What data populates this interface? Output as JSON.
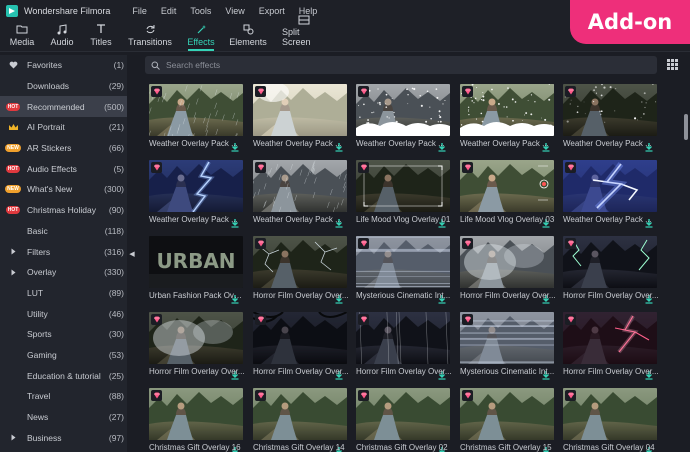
{
  "app": {
    "title": "Wondershare Filmora"
  },
  "menu": [
    "File",
    "Edit",
    "Tools",
    "View",
    "Export",
    "Help"
  ],
  "badge": "Add-on",
  "tabs": [
    {
      "label": "Media",
      "icon": "folder-icon"
    },
    {
      "label": "Audio",
      "icon": "music-note-icon"
    },
    {
      "label": "Titles",
      "icon": "text-t-icon"
    },
    {
      "label": "Transitions",
      "icon": "transition-icon"
    },
    {
      "label": "Effects",
      "icon": "effects-sparkle-icon",
      "active": true
    },
    {
      "label": "Elements",
      "icon": "elements-icon"
    },
    {
      "label": "Split Screen",
      "icon": "split-screen-icon"
    }
  ],
  "sidebar": {
    "items": [
      {
        "label": "Favorites",
        "count": "(1)",
        "icon": "heart-icon"
      },
      {
        "label": "Downloads",
        "count": "(29)",
        "icon": ""
      },
      {
        "label": "Recommended",
        "count": "(500)",
        "icon": "hot-pill",
        "pill": "HOT",
        "active": true
      },
      {
        "label": "AI Portrait",
        "count": "(21)",
        "icon": "crown-icon"
      },
      {
        "label": "AR Stickers",
        "count": "(66)",
        "icon": "new-pill",
        "pill": "NEW"
      },
      {
        "label": "Audio Effects",
        "count": "(5)",
        "icon": "hot-pill",
        "pill": "HOT"
      },
      {
        "label": "What's New",
        "count": "(300)",
        "icon": "new-pill",
        "pill": "NEW"
      },
      {
        "label": "Christmas Holiday",
        "count": "(90)",
        "icon": "hot-pill",
        "pill": "HOT"
      },
      {
        "label": "Basic",
        "count": "(118)",
        "icon": ""
      },
      {
        "label": "Filters",
        "count": "(316)",
        "icon": "expand-arrow-icon"
      },
      {
        "label": "Overlay",
        "count": "(330)",
        "icon": "expand-arrow-icon"
      },
      {
        "label": "LUT",
        "count": "(89)",
        "icon": ""
      },
      {
        "label": "Utility",
        "count": "(46)",
        "icon": ""
      },
      {
        "label": "Sports",
        "count": "(30)",
        "icon": ""
      },
      {
        "label": "Gaming",
        "count": "(53)",
        "icon": ""
      },
      {
        "label": "Education & tutorial",
        "count": "(25)",
        "icon": ""
      },
      {
        "label": "Travel",
        "count": "(88)",
        "icon": ""
      },
      {
        "label": "News",
        "count": "(27)",
        "icon": ""
      },
      {
        "label": "Business",
        "count": "(97)",
        "icon": "expand-arrow-icon"
      }
    ]
  },
  "search": {
    "placeholder": "Search effects"
  },
  "effects": [
    [
      "Weather Overlay Pack ...",
      "Weather Overlay Pack ...",
      "Weather Overlay Pack ...",
      "Weather Overlay Pack ...",
      "Weather Overlay Pack ..."
    ],
    [
      "Weather Overlay Pack ...",
      "Weather Overlay Pack ...",
      "Life Mood Vlog Overlay 01",
      "Life Mood Vlog Overlay 03",
      "Weather Overlay Pack ..."
    ],
    [
      "Urban Fashion Pack Over...",
      "Horror Film Overlay Over...",
      "Mysterious Cinematic Int...",
      "Horror Film Overlay Over...",
      "Horror Film Overlay Over..."
    ],
    [
      "Horror Film Overlay Over...",
      "Horror Film Overlay Over...",
      "Horror Film Overlay Over...",
      "Mysterious Cinematic Int...",
      "Horror Film Overlay Over..."
    ],
    [
      "Christmas Gift Overlay 16",
      "Christmas Gift Overlay 14",
      "Christmas Gift Overlay 02",
      "Christmas Gift Overlay 15",
      "Christmas Gift Overlay 04"
    ]
  ],
  "thumb_text": {
    "urban": "URBAN"
  },
  "colors": {
    "accent": "#35d3b7",
    "badge": "#ee2f7a",
    "hot": "#e0393e",
    "new": "#f0a02c",
    "gem": "#ff5a8a"
  }
}
